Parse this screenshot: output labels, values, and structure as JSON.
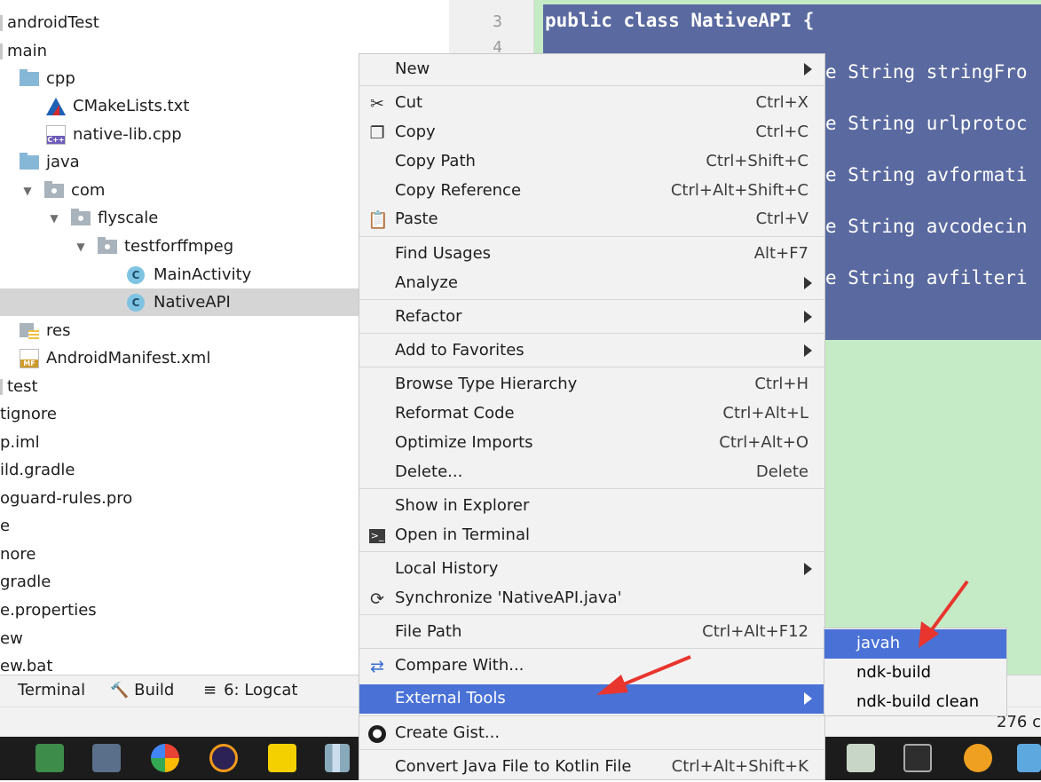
{
  "project_tree": {
    "items": [
      {
        "label": "androidTest"
      },
      {
        "label": "main"
      },
      {
        "label": "cpp"
      },
      {
        "label": "CMakeLists.txt"
      },
      {
        "label": "native-lib.cpp"
      },
      {
        "label": "java"
      },
      {
        "label": "com"
      },
      {
        "label": "flyscale"
      },
      {
        "label": "testforffmpeg"
      },
      {
        "label": "MainActivity"
      },
      {
        "label": "NativeAPI"
      },
      {
        "label": "res"
      },
      {
        "label": "AndroidManifest.xml"
      },
      {
        "label": "test"
      },
      {
        "label": "tignore"
      },
      {
        "label": "p.iml"
      },
      {
        "label": "ild.gradle"
      },
      {
        "label": "oguard-rules.pro"
      },
      {
        "label": "e"
      },
      {
        "label": "nore"
      },
      {
        "label": "gradle"
      },
      {
        "label": "e.properties"
      },
      {
        "label": "ew"
      },
      {
        "label": "ew.bat"
      }
    ],
    "cpp_badge": "C++",
    "manifest_badge": "MF",
    "class_badge": "C"
  },
  "editor": {
    "line_numbers": [
      "3",
      "4"
    ],
    "code_first": "public class NativeAPI {",
    "code_fragments": [
      "e String stringFro",
      "e String urlprotoc",
      "e String avformati",
      "e String avcodecin",
      "e String avfilteri"
    ]
  },
  "context_menu": {
    "items": [
      {
        "label": "New",
        "shortcut": ""
      },
      {
        "label": "Cut",
        "shortcut": "Ctrl+X"
      },
      {
        "label": "Copy",
        "shortcut": "Ctrl+C"
      },
      {
        "label": "Copy Path",
        "shortcut": "Ctrl+Shift+C"
      },
      {
        "label": "Copy Reference",
        "shortcut": "Ctrl+Alt+Shift+C"
      },
      {
        "label": "Paste",
        "shortcut": "Ctrl+V"
      },
      {
        "label": "Find Usages",
        "shortcut": "Alt+F7"
      },
      {
        "label": "Analyze",
        "shortcut": ""
      },
      {
        "label": "Refactor",
        "shortcut": ""
      },
      {
        "label": "Add to Favorites",
        "shortcut": ""
      },
      {
        "label": "Browse Type Hierarchy",
        "shortcut": "Ctrl+H"
      },
      {
        "label": "Reformat Code",
        "shortcut": "Ctrl+Alt+L"
      },
      {
        "label": "Optimize Imports",
        "shortcut": "Ctrl+Alt+O"
      },
      {
        "label": "Delete...",
        "shortcut": "Delete"
      },
      {
        "label": "Show in Explorer",
        "shortcut": ""
      },
      {
        "label": "Open in Terminal",
        "shortcut": ""
      },
      {
        "label": "Local History",
        "shortcut": ""
      },
      {
        "label": "Synchronize 'NativeAPI.java'",
        "shortcut": ""
      },
      {
        "label": "File Path",
        "shortcut": "Ctrl+Alt+F12"
      },
      {
        "label": "Compare With...",
        "shortcut": ""
      },
      {
        "label": "External Tools",
        "shortcut": ""
      },
      {
        "label": "Create Gist...",
        "shortcut": ""
      },
      {
        "label": "Convert Java File to Kotlin File",
        "shortcut": "Ctrl+Alt+Shift+K"
      }
    ]
  },
  "submenu": {
    "items": [
      {
        "label": "javah"
      },
      {
        "label": "ndk-build"
      },
      {
        "label": "ndk-build clean"
      }
    ]
  },
  "tool_window_bar": {
    "terminal": "Terminal",
    "build": "Build",
    "logcat": "6: Logcat"
  },
  "status_bar": {
    "text": "276 c"
  },
  "colors": {
    "menu_highlight": "#4a72d6",
    "selection": "#5a6aa0",
    "editor_bg": "#c5ebc6",
    "arrow": "#e8352e"
  }
}
